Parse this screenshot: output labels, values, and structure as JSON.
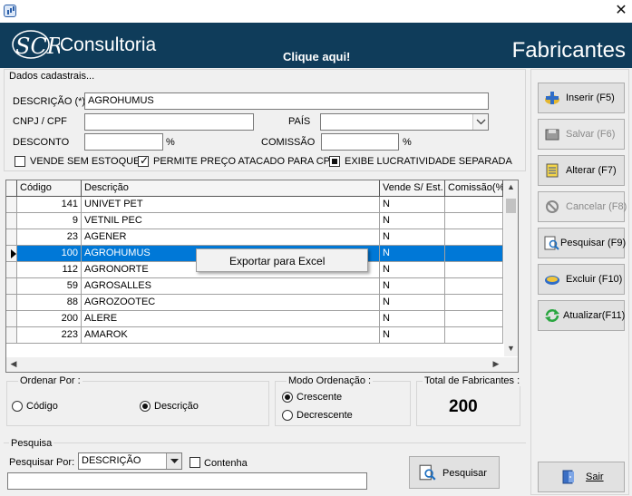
{
  "window": {
    "close_glyph": "✕"
  },
  "banner": {
    "brand": "Consultoria",
    "logo_text": "SCR",
    "link": "Clique aqui!",
    "title": "Fabricantes",
    "bg_color": "#0f3c5a"
  },
  "form": {
    "group_title": "Dados cadastrais...",
    "descricao_label": "DESCRIÇÃO (*)",
    "descricao_value": "AGROHUMUS",
    "cnpj_label": "CNPJ / CPF",
    "cnpj_value": "",
    "pais_label": "PAÍS",
    "pais_value": "",
    "desconto_label": "DESCONTO",
    "desconto_value": "",
    "comissao_label": "COMISSÃO",
    "comissao_value": "",
    "percent": "%",
    "chk_vende": "VENDE SEM ESTOQUE",
    "chk_preco": "PERMITE PREÇO ATACADO PARA CPF",
    "chk_lucro": "EXIBE LUCRATIVIDADE SEPARADA"
  },
  "grid": {
    "columns": [
      "Código",
      "Descrição",
      "Vende S/ Est.",
      "Comissão(%)"
    ],
    "rows": [
      {
        "codigo": "141",
        "descricao": "UNIVET PET",
        "vende": "N",
        "comissao": ""
      },
      {
        "codigo": "9",
        "descricao": "VETNIL PEC",
        "vende": "N",
        "comissao": ""
      },
      {
        "codigo": "23",
        "descricao": "AGENER",
        "vende": "N",
        "comissao": ""
      },
      {
        "codigo": "100",
        "descricao": "AGROHUMUS",
        "vende": "N",
        "comissao": ""
      },
      {
        "codigo": "112",
        "descricao": "AGRONORTE",
        "vende": "N",
        "comissao": ""
      },
      {
        "codigo": "59",
        "descricao": "AGROSALLES",
        "vende": "N",
        "comissao": ""
      },
      {
        "codigo": "88",
        "descricao": "AGROZOOTEC",
        "vende": "N",
        "comissao": ""
      },
      {
        "codigo": "200",
        "descricao": "ALERE",
        "vende": "N",
        "comissao": ""
      },
      {
        "codigo": "223",
        "descricao": "AMAROK",
        "vende": "N",
        "comissao": ""
      }
    ],
    "selected_index": 3,
    "selected_color": "#0078d7",
    "context_menu": "Exportar para Excel"
  },
  "ordenar": {
    "title": "Ordenar Por :",
    "codigo": "Código",
    "descricao": "Descrição"
  },
  "modo": {
    "title": "Modo Ordenação :",
    "crescente": "Crescente",
    "decrescente": "Decrescente"
  },
  "total": {
    "title": "Total de Fabricantes :",
    "value": "200"
  },
  "pesquisa": {
    "title": "Pesquisa",
    "label": "Pesquisar Por:",
    "select_value": "DESCRIÇÃO",
    "contenha": "Contenha",
    "input_value": "",
    "button": "Pesquisar"
  },
  "buttons": {
    "inserir": "Inserir (F5)",
    "salvar": "Salvar (F6)",
    "alterar": "Alterar (F7)",
    "cancelar": "Cancelar (F8)",
    "pesquisar": "Pesquisar (F9)",
    "excluir": "Excluir (F10)",
    "atualizar": "Atualizar(F11)",
    "sair": "Sair"
  }
}
